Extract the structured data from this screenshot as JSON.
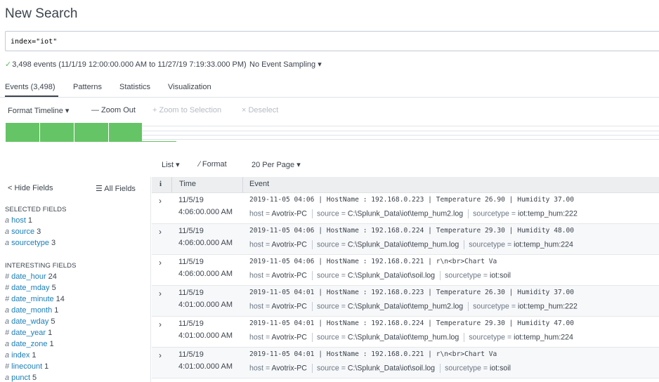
{
  "page": {
    "title": "New Search"
  },
  "search": {
    "query": "index=\"iot\""
  },
  "status": {
    "check_icon": "check-icon",
    "summary": "3,498 events (11/1/19 12:00:00.000 AM to 11/27/19 7:19:33.000 PM)",
    "sampling": "No Event Sampling ▾"
  },
  "tabs": [
    {
      "label": "Events (3,498)",
      "active": true
    },
    {
      "label": "Patterns"
    },
    {
      "label": "Statistics"
    },
    {
      "label": "Visualization"
    }
  ],
  "timeline_toolbar": {
    "format_timeline": "Format Timeline ▾",
    "zoom_out": "— Zoom Out",
    "zoom_selection": "+ Zoom to Selection",
    "deselect": "× Deselect"
  },
  "timeline": {
    "color": "#65c465"
  },
  "list_controls": {
    "list": "List ▾",
    "format": "∕ Format",
    "per_page": "20 Per Page ▾"
  },
  "sidebar": {
    "hide_fields": "< Hide Fields",
    "all_fields": "☰ All Fields",
    "selected_heading": "SELECTED FIELDS",
    "selected": [
      {
        "type": "a",
        "name": "host",
        "count": "1"
      },
      {
        "type": "a",
        "name": "source",
        "count": "3"
      },
      {
        "type": "a",
        "name": "sourcetype",
        "count": "3"
      }
    ],
    "interesting_heading": "INTERESTING FIELDS",
    "interesting": [
      {
        "type": "#",
        "name": "date_hour",
        "count": "24"
      },
      {
        "type": "#",
        "name": "date_mday",
        "count": "5"
      },
      {
        "type": "#",
        "name": "date_minute",
        "count": "14"
      },
      {
        "type": "a",
        "name": "date_month",
        "count": "1"
      },
      {
        "type": "a",
        "name": "date_wday",
        "count": "5"
      },
      {
        "type": "#",
        "name": "date_year",
        "count": "1"
      },
      {
        "type": "a",
        "name": "date_zone",
        "count": "1"
      },
      {
        "type": "a",
        "name": "index",
        "count": "1"
      },
      {
        "type": "#",
        "name": "linecount",
        "count": "1"
      },
      {
        "type": "a",
        "name": "punct",
        "count": "5"
      }
    ]
  },
  "results": {
    "headers": {
      "info": "i",
      "time": "Time",
      "event": "Event"
    },
    "rows": [
      {
        "date": "11/5/19",
        "time": "4:06:00.000 AM",
        "event": "2019-11-05 04:06 | HostName : 192.168.0.223 | Temperature 26.90 | Humidity 37.00",
        "host": "Avotrix-PC",
        "source": "C:\\Splunk_Data\\iot\\temp_hum2.log",
        "sourcetype": "iot:temp_hum:222"
      },
      {
        "date": "11/5/19",
        "time": "4:06:00.000 AM",
        "event": "2019-11-05 04:06 | HostName : 192.168.0.224 | Temperature 29.30 | Humidity 48.00",
        "host": "Avotrix-PC",
        "source": "C:\\Splunk_Data\\iot\\temp_hum.log",
        "sourcetype": "iot:temp_hum:224"
      },
      {
        "date": "11/5/19",
        "time": "4:06:00.000 AM",
        "event": "2019-11-05 04:06 | HostName : 192.168.0.221 | r\\n<br>Chart Va",
        "host": "Avotrix-PC",
        "source": "C:\\Splunk_Data\\iot\\soil.log",
        "sourcetype": "iot:soil"
      },
      {
        "date": "11/5/19",
        "time": "4:01:00.000 AM",
        "event": "2019-11-05 04:01 | HostName : 192.168.0.223 | Temperature 26.30 | Humidity 37.00",
        "host": "Avotrix-PC",
        "source": "C:\\Splunk_Data\\iot\\temp_hum2.log",
        "sourcetype": "iot:temp_hum:222"
      },
      {
        "date": "11/5/19",
        "time": "4:01:00.000 AM",
        "event": "2019-11-05 04:01 | HostName : 192.168.0.224 | Temperature 29.30 | Humidity 47.00",
        "host": "Avotrix-PC",
        "source": "C:\\Splunk_Data\\iot\\temp_hum.log",
        "sourcetype": "iot:temp_hum:224"
      },
      {
        "date": "11/5/19",
        "time": "4:01:00.000 AM",
        "event": "2019-11-05 04:01 | HostName : 192.168.0.221 | r\\n<br>Chart Va",
        "host": "Avotrix-PC",
        "source": "C:\\Splunk_Data\\iot\\soil.log",
        "sourcetype": "iot:soil"
      }
    ],
    "meta_labels": {
      "host": "host = ",
      "source": "source = ",
      "sourcetype": "sourcetype = "
    },
    "expand_icon": "chevron-right-icon"
  }
}
